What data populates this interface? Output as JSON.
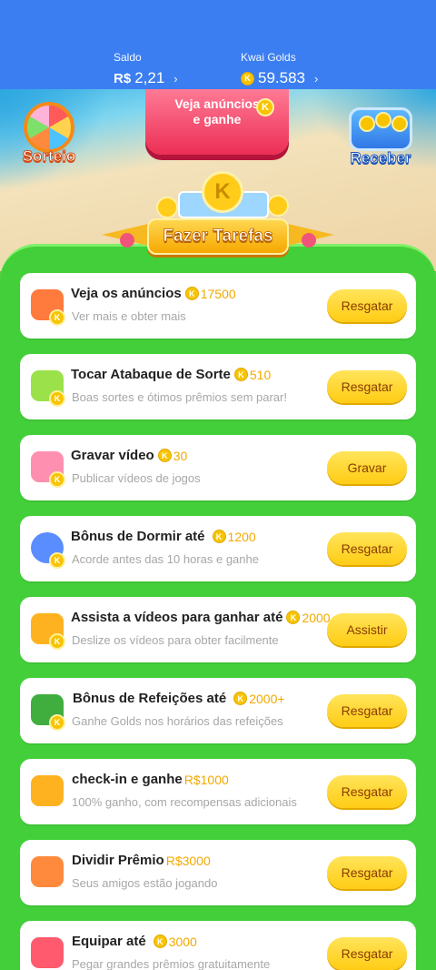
{
  "header": {
    "saldo_label": "Saldo",
    "saldo_currency": "R$",
    "saldo_value": "2,21",
    "golds_label": "Kwai Golds",
    "golds_value": "59.583",
    "arrow": "›"
  },
  "top": {
    "sorteio_label": "Sorteio",
    "ad_button_label_line1": "Veja anúncios",
    "ad_button_label_line2": "e ganhe",
    "receber_label": "Receber",
    "coin_letter": "K"
  },
  "banner": {
    "title": "Fazer Tarefas"
  },
  "tasks": [
    {
      "title": "Veja os anúncios",
      "reward": "17500",
      "subtitle": "Ver mais e obter mais",
      "button": "Resgatar",
      "icon": "tv-icon",
      "color": "#ff7a3d"
    },
    {
      "title": "Tocar Atabaque de Sorte",
      "reward": "510",
      "subtitle": "Boas sortes e ótimos prêmios sem parar!",
      "button": "Resgatar",
      "icon": "drum-icon",
      "color": "#9be24a"
    },
    {
      "title": "Gravar vídeo",
      "reward": "30",
      "subtitle": "Publicar vídeos de jogos",
      "button": "Gravar",
      "icon": "video-record-icon",
      "color": "#ff8fb0"
    },
    {
      "title": "Bônus de Dormir até",
      "reward": "1200",
      "subtitle": "Acorde antes das 10 horas e ganhe",
      "button": "Resgatar",
      "icon": "moon-icon",
      "color": "#5a8dff"
    },
    {
      "title": "Assista a vídeos para ganhar até",
      "reward": "2000",
      "subtitle": "Deslize os vídeos para obter facilmente",
      "button": "Assistir",
      "icon": "camera-icon",
      "color": "#ffb21f"
    },
    {
      "title": "Bônus de Refeições até",
      "reward": "2000+",
      "subtitle": "Ganhe Golds nos horários das refeições",
      "button": "Resgatar",
      "icon": "meal-box-icon",
      "color": "#3fae3f"
    },
    {
      "title": "check-in e ganhe",
      "reward": "R$1000",
      "subtitle": "100% ganho, com recompensas adicionais",
      "button": "Resgatar",
      "icon": "calendar-icon",
      "color": "#ffb21f",
      "money": true
    },
    {
      "title": "Dividir Prêmio",
      "reward": "R$3000",
      "subtitle": "Seus amigos estão jogando",
      "button": "Resgatar",
      "icon": "gift-icon",
      "color": "#ff8a3d",
      "money": true
    },
    {
      "title": "Equipar até",
      "reward": "3000",
      "subtitle": "Pegar grandes prêmios gratuitamente",
      "button": "Resgatar",
      "icon": "gloves-icon",
      "color": "#ff5a6e"
    }
  ]
}
